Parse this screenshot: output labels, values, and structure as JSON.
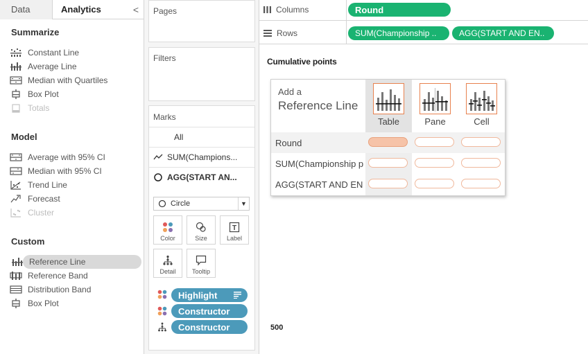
{
  "left_panel": {
    "tabs": [
      "Data",
      "Analytics"
    ],
    "collapse_glyph": "<",
    "sections": [
      {
        "title": "Summarize",
        "items": [
          {
            "label": "Constant Line",
            "icon": "constant-line-icon",
            "disabled": false
          },
          {
            "label": "Average Line",
            "icon": "average-line-icon",
            "disabled": false
          },
          {
            "label": "Median with Quartiles",
            "icon": "median-quartiles-icon",
            "disabled": false
          },
          {
            "label": "Box Plot",
            "icon": "box-plot-icon",
            "disabled": false
          },
          {
            "label": "Totals",
            "icon": "totals-icon",
            "disabled": true
          }
        ]
      },
      {
        "title": "Model",
        "items": [
          {
            "label": "Average with 95% CI",
            "icon": "average-ci-icon",
            "disabled": false
          },
          {
            "label": "Median with 95% CI",
            "icon": "median-ci-icon",
            "disabled": false
          },
          {
            "label": "Trend Line",
            "icon": "trend-line-icon",
            "disabled": false
          },
          {
            "label": "Forecast",
            "icon": "forecast-icon",
            "disabled": false
          },
          {
            "label": "Cluster",
            "icon": "cluster-icon",
            "disabled": true
          }
        ]
      },
      {
        "title": "Custom",
        "items": [
          {
            "label": "Reference Line",
            "icon": "reference-line-icon",
            "selected": true
          },
          {
            "label": "Reference Band",
            "icon": "reference-band-icon"
          },
          {
            "label": "Distribution Band",
            "icon": "distribution-band-icon"
          },
          {
            "label": "Box Plot",
            "icon": "box-plot-icon"
          }
        ]
      }
    ]
  },
  "shelves": {
    "pages": "Pages",
    "filters": "Filters",
    "columns_label": "Columns",
    "rows_label": "Rows",
    "columns_pills": [
      "Round"
    ],
    "rows_pills": [
      "SUM(Championship ..",
      "AGG(START AND EN.."
    ]
  },
  "marks": {
    "title": "Marks",
    "rows": [
      "All",
      "SUM(Champions...",
      "AGG(START AN..."
    ],
    "mark_type": "Circle",
    "buttons": [
      "Color",
      "Size",
      "Label",
      "Detail",
      "Tooltip"
    ],
    "pills": [
      {
        "label": "Highlight",
        "icon": "color-icon"
      },
      {
        "label": "Constructor",
        "icon": "color-icon"
      },
      {
        "label": "Constructor",
        "icon": "detail-icon"
      }
    ]
  },
  "view": {
    "title": "Cumulative points",
    "axis_value": "500"
  },
  "popup": {
    "title_line1": "Add a",
    "title_line2": "Reference Line",
    "scopes": [
      "Table",
      "Pane",
      "Cell"
    ],
    "active_scope": "Table",
    "rows": [
      "Round",
      "SUM(Championship p",
      "AGG(START AND EN"
    ]
  },
  "colors": {
    "green_pill": "#1ab371",
    "blue_pill": "#4c9aba",
    "accent_orange": "#e8814e"
  }
}
